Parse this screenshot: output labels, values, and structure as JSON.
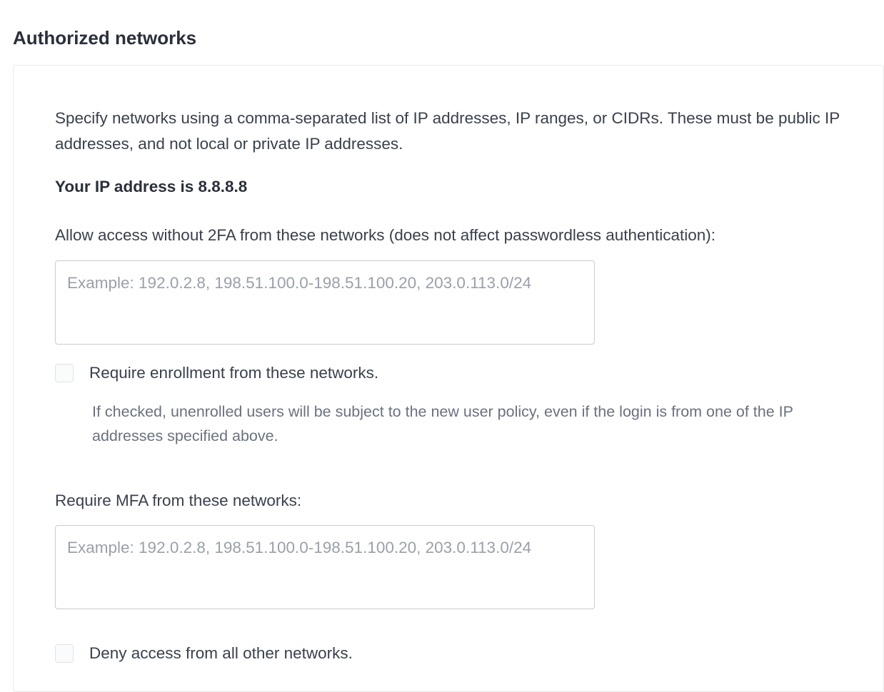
{
  "title": "Authorized networks",
  "intro": "Specify networks using a comma-separated list of IP addresses, IP ranges, or CIDRs. These must be public IP addresses, and not local or private IP addresses.",
  "ip_line": "Your IP address is 8.8.8.8",
  "allow": {
    "label": "Allow access without 2FA from these networks (does not affect passwordless authentication):",
    "placeholder": "Example: 192.0.2.8, 198.51.100.0-198.51.100.20, 203.0.113.0/24",
    "value": "",
    "require_enrollment_label": "Require enrollment from these networks.",
    "require_enrollment_help": "If checked, unenrolled users will be subject to the new user policy, even if the login is from one of the IP addresses specified above."
  },
  "require_mfa": {
    "label": "Require MFA from these networks:",
    "placeholder": "Example: 192.0.2.8, 198.51.100.0-198.51.100.20, 203.0.113.0/24",
    "value": ""
  },
  "deny": {
    "label": "Deny access from all other networks."
  }
}
